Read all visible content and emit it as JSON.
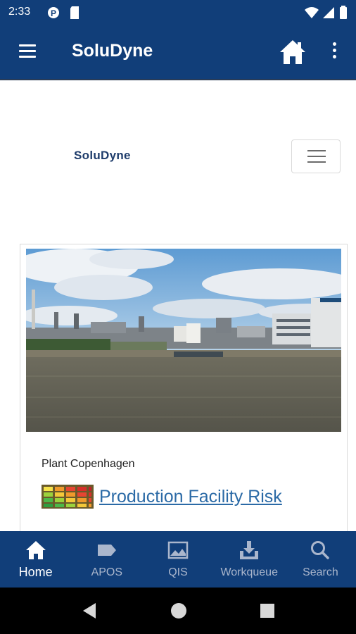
{
  "status_bar": {
    "time": "2:33",
    "left_icons": [
      "data-saver-icon",
      "sd-card-icon"
    ],
    "right_icons": [
      "wifi-icon",
      "signal-icon",
      "battery-icon"
    ]
  },
  "app_bar": {
    "title": "SoluDyne",
    "menu_icon": "hamburger-menu-icon",
    "home_icon": "home-icon",
    "more_icon": "more-vert-icon"
  },
  "page": {
    "brand": "SoluDyne",
    "toggler_icon": "hamburger-menu-icon"
  },
  "card": {
    "image_alt": "Industrial plant on the waterfront",
    "plant_name": "Plant Copenhagen",
    "risk_icon": "risk-heatmap-icon",
    "link_text": "Production Facility Risk"
  },
  "bottom_nav": {
    "items": [
      {
        "label": "Home",
        "icon": "home-icon",
        "active": true
      },
      {
        "label": "APOS",
        "icon": "tag-icon",
        "active": false
      },
      {
        "label": "QIS",
        "icon": "image-icon",
        "active": false
      },
      {
        "label": "Workqueue",
        "icon": "download-tray-icon",
        "active": false
      },
      {
        "label": "Search",
        "icon": "search-icon",
        "active": false
      }
    ]
  },
  "colors": {
    "primary": "#113e79",
    "link": "#2b6aa6",
    "brand_text": "#1e3c6b"
  }
}
